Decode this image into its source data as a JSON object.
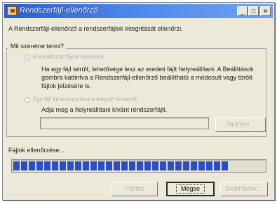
{
  "window": {
    "title": "Rendszerfájl-ellenőrző",
    "controls": {
      "minimize": "_",
      "maximize": "□",
      "close": "✕"
    }
  },
  "intro_text": "A Rendszerfájl-ellenőrző a rendszerfájlok integritását ellenőrzi.",
  "group": {
    "title": "Mit szeretne tenni?",
    "options": [
      {
        "label": "Megváltozott fájlok keresése",
        "selected": true,
        "enabled": false,
        "description": "Ha egy fájl sérült, lehetősége lesz az eredeti fájlt helyreállítani. A Beállítások gombra kattintva a Rendszerfájl-ellenőrző beállítható a módosult vagy törölt fájlok jelzésére is."
      },
      {
        "label": "Egy fájl kicsomagolása a telepítő lemezről",
        "selected": false,
        "enabled": false,
        "prompt": "Adja meg a helyreállítani kívánt rendszerfájlt.",
        "file_value": "",
        "browse_label": "Tallózás..."
      }
    ]
  },
  "progress": {
    "label": "Fájlok ellenőrzése...",
    "fraction": 0.86
  },
  "buttons": {
    "start": "Indítás",
    "close": "Mégse",
    "settings": "Beállítások..."
  },
  "colors": {
    "titlebar": "#2a5cd0",
    "progress_fill": "#2b4ec0",
    "face": "#ece9d8"
  }
}
